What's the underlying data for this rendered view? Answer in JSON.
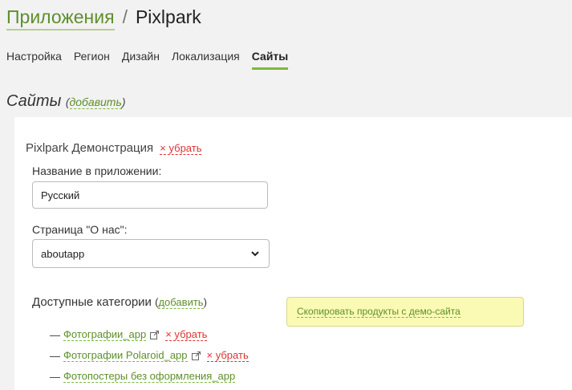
{
  "header": {
    "app_link": "Приложения",
    "separator": "/",
    "app_name": "Pixlpark"
  },
  "tabs": [
    {
      "label": "Настройка",
      "active": false
    },
    {
      "label": "Регион",
      "active": false
    },
    {
      "label": "Дизайн",
      "active": false
    },
    {
      "label": "Локализация",
      "active": false
    },
    {
      "label": "Сайты",
      "active": true
    }
  ],
  "section": {
    "title": "Сайты",
    "add_label": "добавить"
  },
  "site": {
    "name": "Pixlpark Демонстрация",
    "remove_label": "× убрать",
    "app_name_label": "Название в приложении:",
    "app_name_value": "Русский",
    "about_label": "Страница \"О нас\":",
    "about_value": "aboutapp",
    "categories_title": "Доступные категории",
    "categories_add_label": "добавить",
    "categories": [
      {
        "name": "Фотографии_app",
        "remove_label": "× убрать"
      },
      {
        "name": "Фотографии Polaroid_app",
        "remove_label": "× убрать"
      },
      {
        "name": "Фотопостеры без оформления_app"
      }
    ],
    "copy_demo_label": "Скопировать продукты с демо-сайта"
  },
  "colors": {
    "accent_green": "#5e8f2c",
    "tab_underline": "#7cb93a",
    "remove_red": "#d33",
    "demo_box_bg": "#fafab4"
  }
}
